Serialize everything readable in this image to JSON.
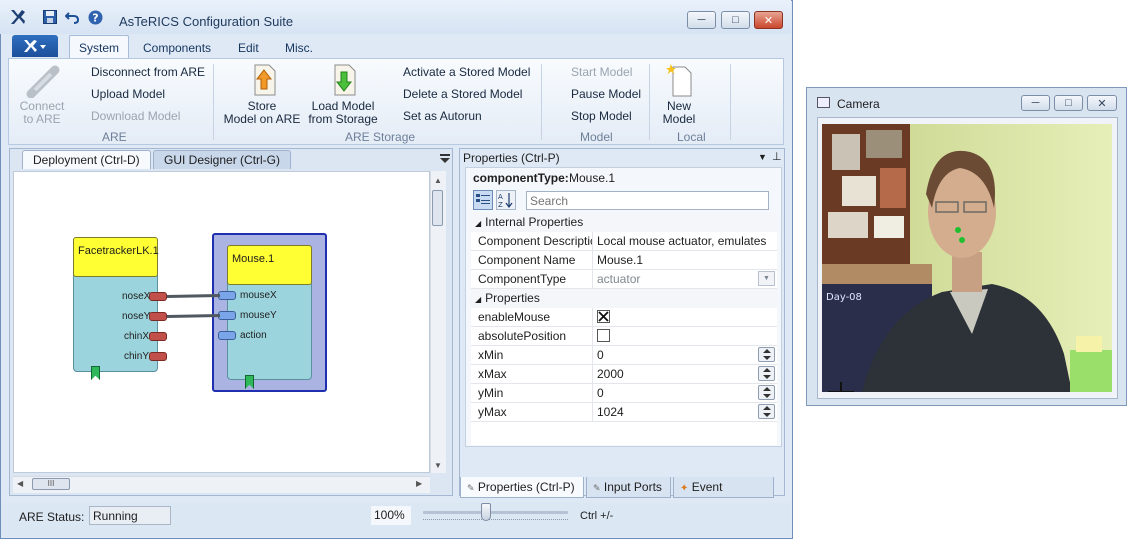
{
  "window": {
    "title": "AsTeRICS Configuration Suite",
    "tabs": [
      "System",
      "Components",
      "Edit",
      "Misc."
    ]
  },
  "ribbon": {
    "are": {
      "connect": "Connect\nto ARE",
      "disconnect": "Disconnect from ARE",
      "upload": "Upload Model",
      "download": "Download Model",
      "group": "ARE"
    },
    "storage": {
      "store": "Store\nModel on ARE",
      "load": "Load Model\nfrom Storage",
      "activate": "Activate a Stored Model",
      "delete": "Delete a Stored Model",
      "autorun": "Set as Autorun",
      "group": "ARE Storage"
    },
    "model": {
      "start": "Start Model",
      "pause": "Pause Model",
      "stop": "Stop Model",
      "group": "Model"
    },
    "local": {
      "new": "New\nModel",
      "group": "Local"
    }
  },
  "deployment": {
    "tabs": [
      "Deployment (Ctrl-D)",
      "GUI Designer (Ctrl-G)"
    ],
    "components": [
      {
        "name": "FacetrackerLK.1",
        "outputs": [
          "noseX",
          "noseY",
          "chinX",
          "chinY"
        ]
      },
      {
        "name": "Mouse.1",
        "inputs": [
          "mouseX",
          "mouseY",
          "action"
        ]
      }
    ],
    "scroll_label": "III"
  },
  "properties": {
    "title": "Properties (Ctrl-P)",
    "component_type_label": "componentType:",
    "component_type_value": "Mouse.1",
    "search_placeholder": "Search",
    "categories": {
      "internal": "Internal Properties",
      "props": "Properties"
    },
    "internal": [
      {
        "name": "Component Descriptic",
        "value": "Local mouse actuator, emulates"
      },
      {
        "name": "Component Name",
        "value": "Mouse.1"
      },
      {
        "name": "ComponentType",
        "value": "actuator"
      }
    ],
    "props": [
      {
        "name": "enableMouse"
      },
      {
        "name": "absolutePosition"
      },
      {
        "name": "xMin",
        "value": "0"
      },
      {
        "name": "xMax",
        "value": "2000"
      },
      {
        "name": "yMin",
        "value": "0"
      },
      {
        "name": "yMax",
        "value": "1024"
      }
    ],
    "enable_mouse_checked": true,
    "absolute_position_checked": false,
    "bottom_tabs": [
      "Properties (Ctrl-P)",
      "Input Ports",
      "Event Listener"
    ]
  },
  "status": {
    "label": "ARE Status:",
    "value": "Running",
    "zoom": "100%",
    "zoom_hint": "Ctrl +/-"
  },
  "camera": {
    "title": "Camera",
    "banner_text": "Day-08"
  },
  "colors": {
    "component_header": "#ffff33",
    "component_body": "#9bd4dc",
    "port_out": "#c2504a",
    "port_in": "#7aa5e8",
    "selection": "#1f2fb0"
  }
}
